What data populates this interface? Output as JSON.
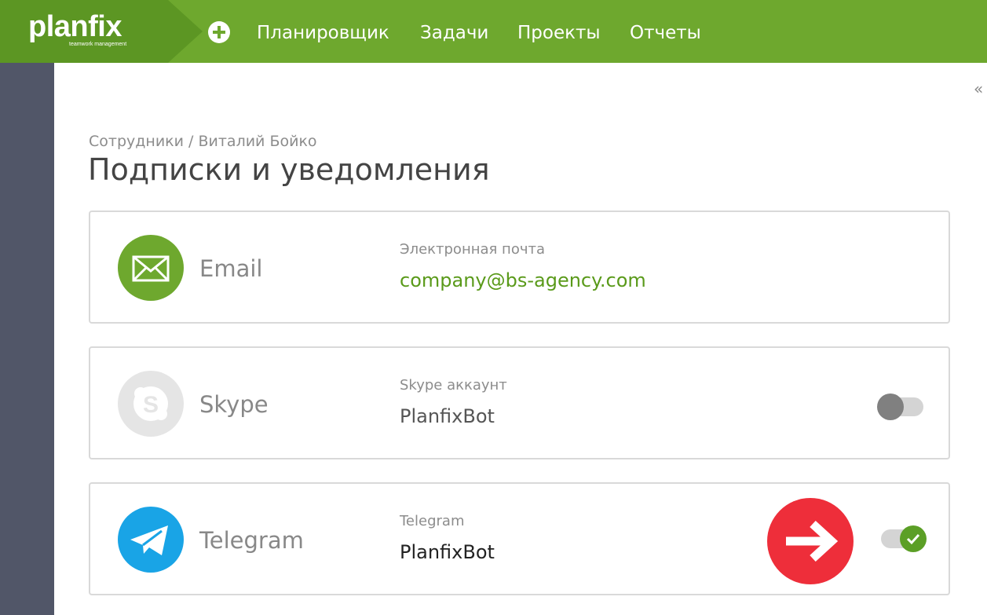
{
  "header": {
    "logo": "planfix",
    "logo_tagline": "teamwork management",
    "add_icon": "plus-circle-icon",
    "nav": [
      "Планировщик",
      "Задачи",
      "Проекты",
      "Отчеты"
    ]
  },
  "collapse_icon": "double-chevron-left-icon",
  "breadcrumb": "Сотрудники / Виталий Бойко",
  "title": "Подписки и уведомления",
  "channels": [
    {
      "name": "Email",
      "field_label": "Электронная почта",
      "value": "company@bs-agency.com",
      "icon": "envelope-icon",
      "icon_color": "#6ea82e",
      "value_color": "#5a9a1a"
    },
    {
      "name": "Skype",
      "field_label": "Skype аккаунт",
      "value": "PlanfixBot",
      "icon": "skype-icon",
      "icon_color": "#e5e5e5",
      "enabled": false
    },
    {
      "name": "Telegram",
      "field_label": "Telegram",
      "value": "PlanfixBot",
      "icon": "telegram-icon",
      "icon_color": "#19a4e6",
      "enabled": true
    }
  ],
  "colors": {
    "brand_green": "#6ea82e",
    "sidebar": "#515668",
    "arrow_badge": "#ee2e3a"
  },
  "annotation_icon": "arrow-right-icon"
}
